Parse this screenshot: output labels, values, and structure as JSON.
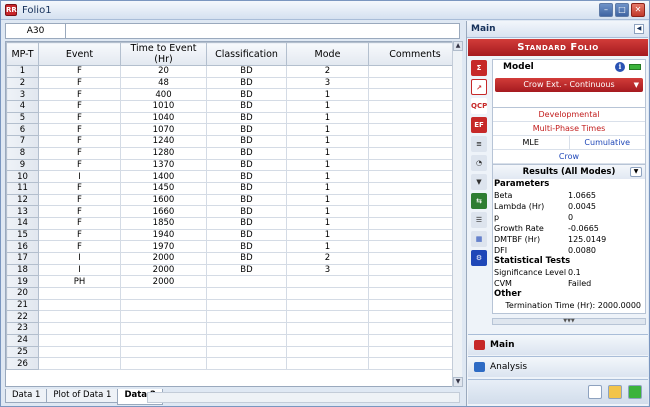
{
  "window": {
    "title": "Folio1",
    "app_icon": "RR"
  },
  "formula_bar": {
    "cell_ref": "A30",
    "content": ""
  },
  "sheet": {
    "columns": [
      "MP-T",
      "Event",
      "Time to Event (Hr)",
      "Classification",
      "Mode",
      "Comments"
    ],
    "rows": [
      [
        "1",
        "F",
        "20",
        "BD",
        "2",
        ""
      ],
      [
        "2",
        "F",
        "48",
        "BD",
        "3",
        ""
      ],
      [
        "3",
        "F",
        "400",
        "BD",
        "1",
        ""
      ],
      [
        "4",
        "F",
        "1010",
        "BD",
        "1",
        ""
      ],
      [
        "5",
        "F",
        "1040",
        "BD",
        "1",
        ""
      ],
      [
        "6",
        "F",
        "1070",
        "BD",
        "1",
        ""
      ],
      [
        "7",
        "F",
        "1240",
        "BD",
        "1",
        ""
      ],
      [
        "8",
        "F",
        "1280",
        "BD",
        "1",
        ""
      ],
      [
        "9",
        "F",
        "1370",
        "BD",
        "1",
        ""
      ],
      [
        "10",
        "I",
        "1400",
        "BD",
        "1",
        ""
      ],
      [
        "11",
        "F",
        "1450",
        "BD",
        "1",
        ""
      ],
      [
        "12",
        "F",
        "1600",
        "BD",
        "1",
        ""
      ],
      [
        "13",
        "F",
        "1660",
        "BD",
        "1",
        ""
      ],
      [
        "14",
        "F",
        "1850",
        "BD",
        "1",
        ""
      ],
      [
        "15",
        "F",
        "1940",
        "BD",
        "1",
        ""
      ],
      [
        "16",
        "F",
        "1970",
        "BD",
        "1",
        ""
      ],
      [
        "17",
        "I",
        "2000",
        "BD",
        "2",
        ""
      ],
      [
        "18",
        "I",
        "2000",
        "BD",
        "3",
        ""
      ],
      [
        "19",
        "PH",
        "2000",
        "",
        "",
        ""
      ],
      [
        "20",
        "",
        "",
        "",
        "",
        ""
      ],
      [
        "21",
        "",
        "",
        "",
        "",
        ""
      ],
      [
        "22",
        "",
        "",
        "",
        "",
        ""
      ],
      [
        "23",
        "",
        "",
        "",
        "",
        ""
      ],
      [
        "24",
        "",
        "",
        "",
        "",
        ""
      ],
      [
        "25",
        "",
        "",
        "",
        "",
        ""
      ],
      [
        "26",
        "",
        "",
        "",
        "",
        ""
      ]
    ]
  },
  "sheet_tabs": [
    "Data 1",
    "Plot of Data 1",
    "Data 2"
  ],
  "active_tab": "Data 2",
  "panel": {
    "header": "Main",
    "banner": "Standard Folio",
    "model": {
      "title": "Model",
      "selected": "Crow Ext. - Continuous"
    },
    "options": {
      "developmental": "Developmental",
      "multiphase": "Multi-Phase Times",
      "mle": "MLE",
      "cumulative": "Cumulative",
      "crow": "Crow"
    },
    "results": {
      "title": "Results (All Modes)",
      "parameters_label": "Parameters",
      "parameters": [
        {
          "k": "Beta",
          "v": "1.0665"
        },
        {
          "k": "Lambda (Hr)",
          "v": "0.0045"
        },
        {
          "k": "p",
          "v": "0"
        },
        {
          "k": "Growth Rate",
          "v": "-0.0665"
        },
        {
          "k": "DMTBF (Hr)",
          "v": "125.0149"
        },
        {
          "k": "DFI",
          "v": "0.0080"
        }
      ],
      "tests_label": "Statistical Tests",
      "tests": [
        {
          "k": "Significance Level",
          "v": "0.1"
        },
        {
          "k": "CVM",
          "v": "Failed"
        }
      ],
      "other_label": "Other",
      "termination": "Termination Time (Hr): 2000.0000"
    },
    "nav_main": "Main",
    "nav_analysis": "Analysis"
  },
  "colors": {
    "accent_red": "#b8262a",
    "link_blue": "#1f47b8"
  }
}
